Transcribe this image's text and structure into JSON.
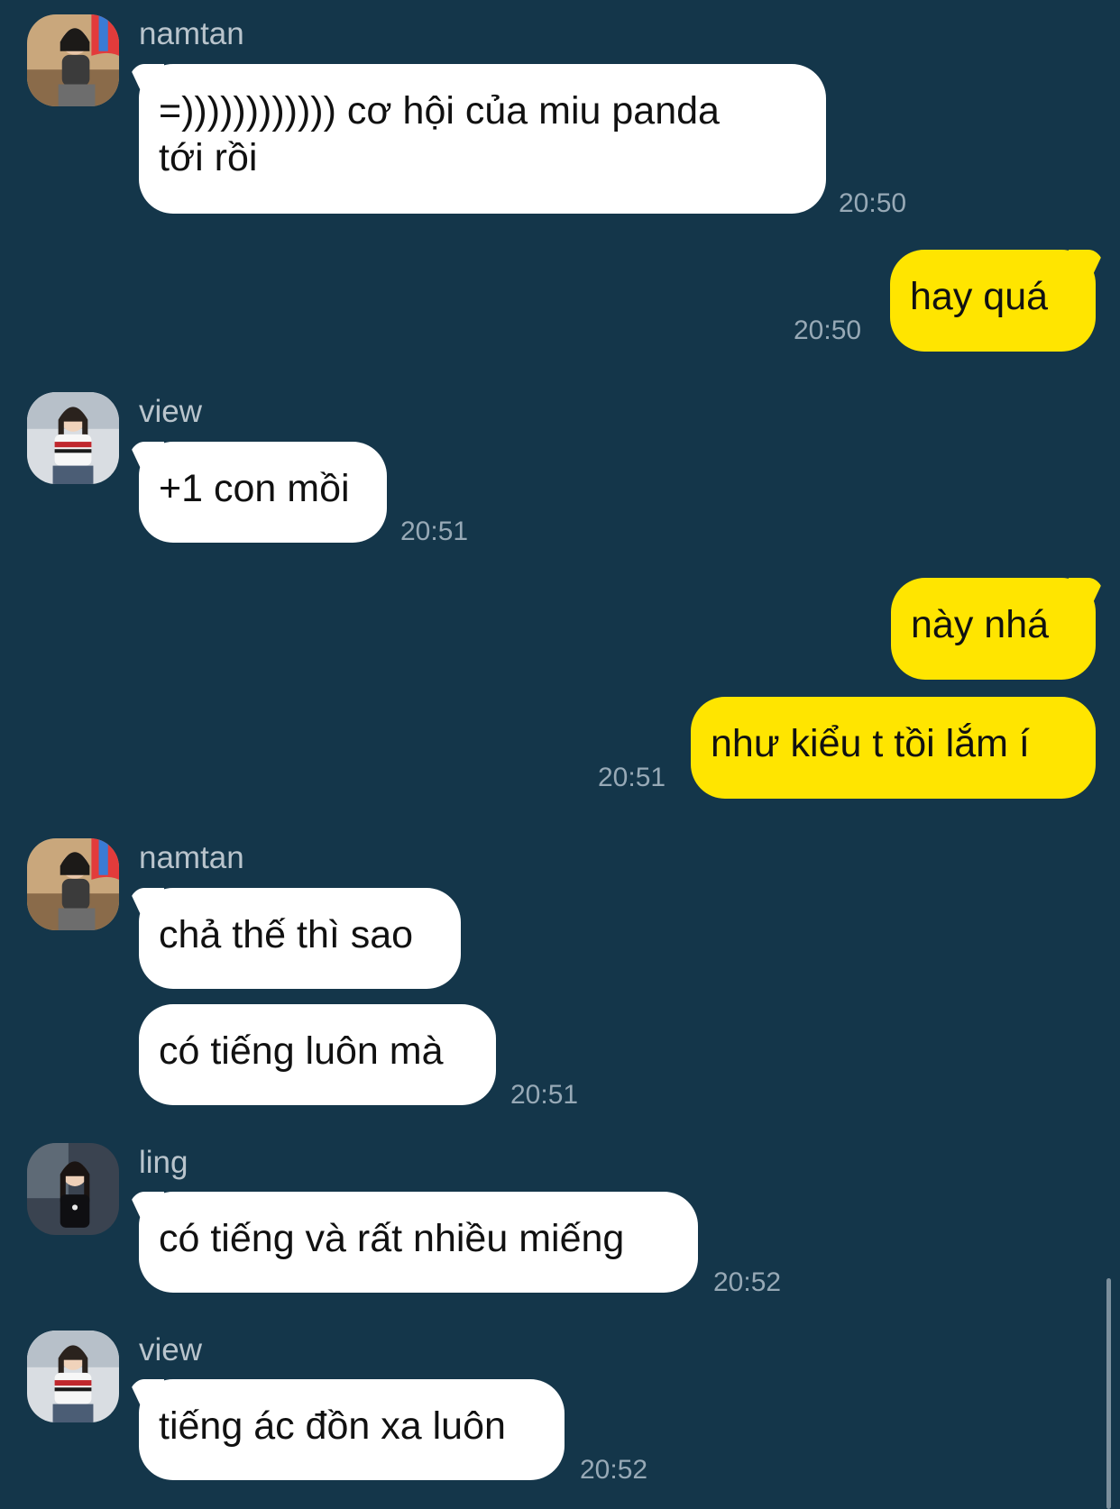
{
  "messages": [
    {
      "sender": "namtan",
      "texts": [
        "=)))))))))))) cơ hội của miu panda",
        "tới rồi"
      ],
      "time": "20:50"
    },
    {
      "outgoing": true,
      "texts": [
        "hay quá"
      ],
      "time": "20:50"
    },
    {
      "sender": "view",
      "texts": [
        "+1 con mồi"
      ],
      "time": "20:51"
    },
    {
      "outgoing": true,
      "texts": [
        "này nhá",
        "như kiểu t tồi lắm í"
      ],
      "time": "20:51"
    },
    {
      "sender": "namtan",
      "texts": [
        "chả thế thì sao",
        "có tiếng luôn mà"
      ],
      "time": "20:51"
    },
    {
      "sender": "ling",
      "texts": [
        "có tiếng và rất nhiều miếng"
      ],
      "time": "20:52"
    },
    {
      "sender": "view",
      "texts": [
        "tiếng ác đồn xa luôn"
      ],
      "time": "20:52"
    }
  ],
  "colors": {
    "background": "#14364a",
    "incoming": "#ffffff",
    "outgoing": "#ffe500"
  }
}
